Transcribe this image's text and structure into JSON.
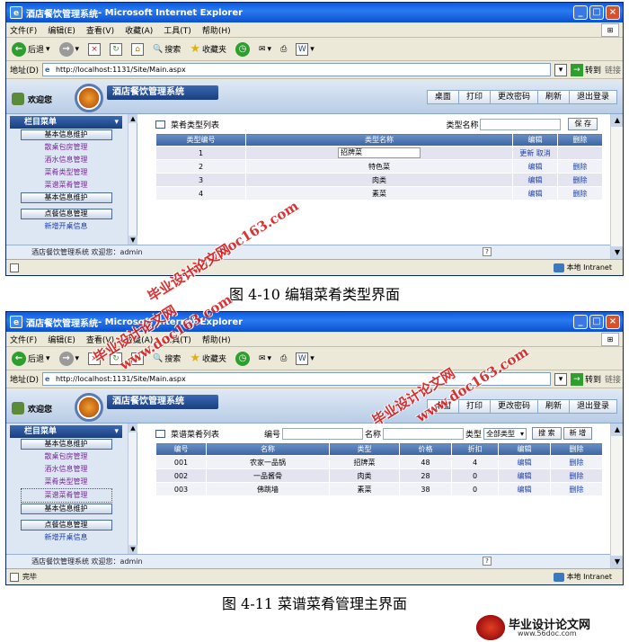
{
  "browser": {
    "app_suffix": " - Microsoft Internet Explorer",
    "menu": [
      "文件(F)",
      "编辑(E)",
      "查看(V)",
      "收藏(A)",
      "工具(T)",
      "帮助(H)"
    ],
    "toolbar": {
      "back": "后退",
      "search": "搜索",
      "favorites": "收藏夹"
    },
    "address_label": "地址(D)",
    "url": "http://localhost:1131/Site/Main.aspx",
    "go": "转到",
    "links": "链接",
    "zone": "本地 Intranet"
  },
  "app": {
    "welcome": "欢迎您",
    "system_title": "酒店餐饮管理系统",
    "header_buttons": [
      "桌面",
      "打印",
      "更改密码",
      "刷新",
      "退出登录"
    ],
    "sidebar": {
      "head": "栏目菜单",
      "group1": "基本信息维护",
      "links": [
        "散桌包房管理",
        "酒水信息管理",
        "菜肴类型管理",
        "菜谱菜肴管理"
      ],
      "group2": "基本信息维护",
      "group3": "点餐信息管理",
      "tail": "新增开桌信息"
    },
    "status": "酒店餐饮管理系统  欢迎您：admin"
  },
  "shot1": {
    "window_title": "酒店餐饮管理系统",
    "status": "",
    "panel_title": "菜肴类型列表",
    "filter_label": "类型名称",
    "save_button": "保 存",
    "columns": [
      "类型编号",
      "类型名称",
      "编辑",
      "删除"
    ],
    "rows": [
      {
        "id": "1",
        "name": "招牌菜",
        "edit1": "更新",
        "edit2": "取消",
        "del": ""
      },
      {
        "id": "2",
        "name": "特色菜",
        "edit1": "编辑",
        "edit2": "",
        "del": "删除"
      },
      {
        "id": "3",
        "name": "肉类",
        "edit1": "编辑",
        "edit2": "",
        "del": "删除"
      },
      {
        "id": "4",
        "name": "素菜",
        "edit1": "编辑",
        "edit2": "",
        "del": "删除"
      }
    ]
  },
  "caption1": "图 4-10 编辑菜肴类型界面",
  "shot2": {
    "window_title": "酒店餐饮管理系统",
    "status": "完毕",
    "panel_title": "菜谱菜肴列表",
    "filter": {
      "id": "编号",
      "name": "名称",
      "type": "类型",
      "type_value": "全部类型",
      "search": "搜 索",
      "add": "新 增"
    },
    "columns": [
      "编号",
      "名称",
      "类型",
      "价格",
      "折扣",
      "编辑",
      "删除"
    ],
    "rows": [
      {
        "id": "001",
        "name": "农家一品锅",
        "type": "招牌菜",
        "price": "48",
        "disc": "4",
        "edit": "编辑",
        "del": "删除"
      },
      {
        "id": "002",
        "name": "一品酱骨",
        "type": "肉类",
        "price": "28",
        "disc": "0",
        "edit": "编辑",
        "del": "删除"
      },
      {
        "id": "003",
        "name": "佛跳墙",
        "type": "素菜",
        "price": "38",
        "disc": "0",
        "edit": "编辑",
        "del": "删除"
      }
    ]
  },
  "caption2": "图 4-11 菜谱菜肴管理主界面",
  "watermarks": [
    "毕业设计论文网",
    "www.doc163.com"
  ],
  "brand": {
    "name": "毕业设计论文网",
    "url": "www.56doc.com"
  }
}
